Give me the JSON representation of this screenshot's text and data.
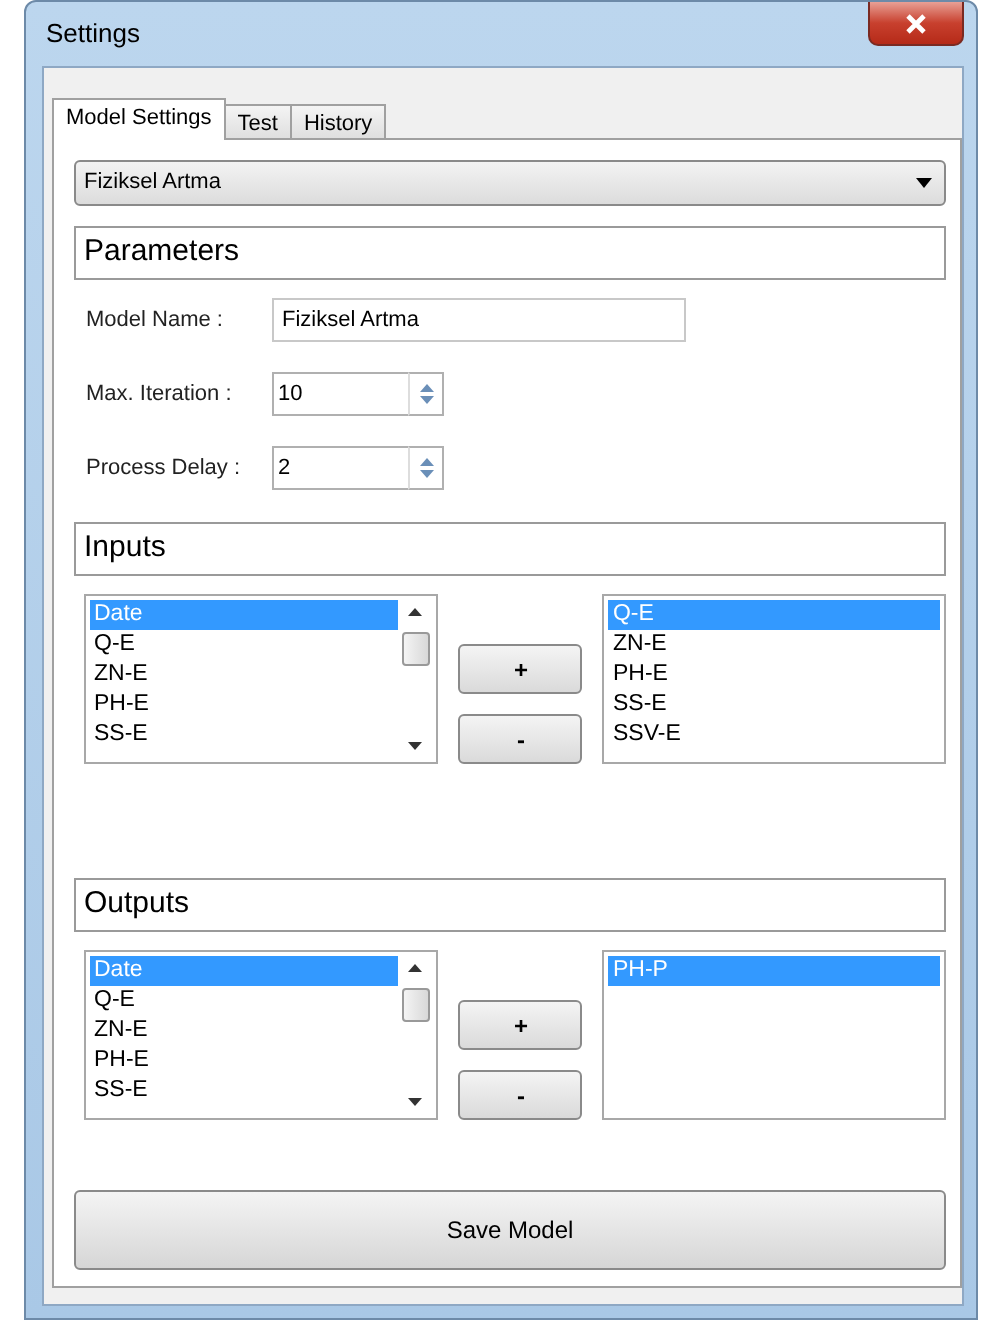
{
  "window": {
    "title": "Settings"
  },
  "tabs": [
    {
      "label": "Model Settings",
      "selected": true
    },
    {
      "label": "Test",
      "selected": false
    },
    {
      "label": "History",
      "selected": false
    }
  ],
  "model_select": {
    "value": "Fiziksel Artma"
  },
  "parameters": {
    "title": "Parameters",
    "fields": [
      {
        "label": "Model Name :",
        "value": "Fiziksel Artma",
        "kind": "text"
      },
      {
        "label": "Max. Iteration :",
        "value": "10",
        "kind": "spin"
      },
      {
        "label": "Process Delay :",
        "value": "2",
        "kind": "spin"
      }
    ]
  },
  "inputs": {
    "title": "Inputs",
    "available": [
      {
        "label": "Date",
        "selected": true
      },
      {
        "label": "Q-E",
        "selected": false
      },
      {
        "label": "ZN-E",
        "selected": false
      },
      {
        "label": "PH-E",
        "selected": false
      },
      {
        "label": "SS-E",
        "selected": false
      }
    ],
    "add_button": "+",
    "remove_button": "-",
    "chosen": [
      {
        "label": "Q-E",
        "selected": true
      },
      {
        "label": "ZN-E",
        "selected": false
      },
      {
        "label": "PH-E",
        "selected": false
      },
      {
        "label": "SS-E",
        "selected": false
      },
      {
        "label": "SSV-E",
        "selected": false
      }
    ]
  },
  "outputs": {
    "title": "Outputs",
    "available": [
      {
        "label": "Date",
        "selected": true
      },
      {
        "label": "Q-E",
        "selected": false
      },
      {
        "label": "ZN-E",
        "selected": false
      },
      {
        "label": "PH-E",
        "selected": false
      },
      {
        "label": "SS-E",
        "selected": false
      }
    ],
    "add_button": "+",
    "remove_button": "-",
    "chosen": [
      {
        "label": "PH-P",
        "selected": true
      }
    ]
  },
  "save_button": "Save Model"
}
